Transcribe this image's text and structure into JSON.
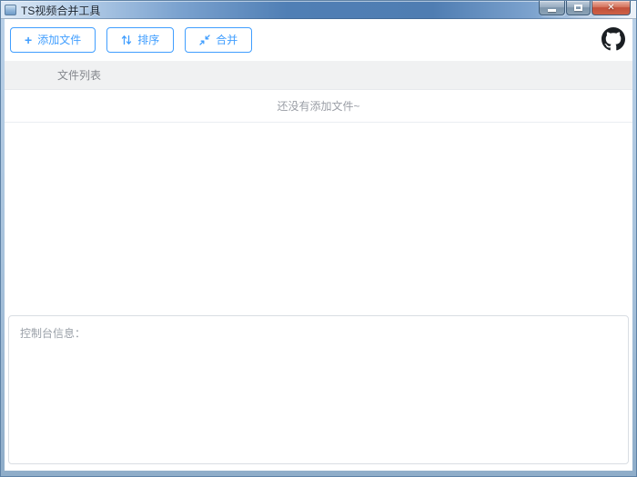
{
  "window": {
    "title": "TS视频合并工具",
    "controls": {
      "minimize": "minimize",
      "maximize": "maximize",
      "close_glyph": "✕"
    }
  },
  "toolbar": {
    "add_label": "添加文件",
    "add_icon_glyph": "+",
    "sort_label": "排序",
    "merge_label": "合并"
  },
  "file_table": {
    "header_label": "文件列表",
    "empty_text": "还没有添加文件~",
    "rows": []
  },
  "console": {
    "label": "控制台信息："
  },
  "colors": {
    "primary_blue": "#409eff",
    "titlebar_blue": "#4f7fb5",
    "close_red": "#c2503a",
    "header_bg": "#f0f1f2",
    "muted_text": "#9a9ea6",
    "github_black": "#1b1f23"
  }
}
